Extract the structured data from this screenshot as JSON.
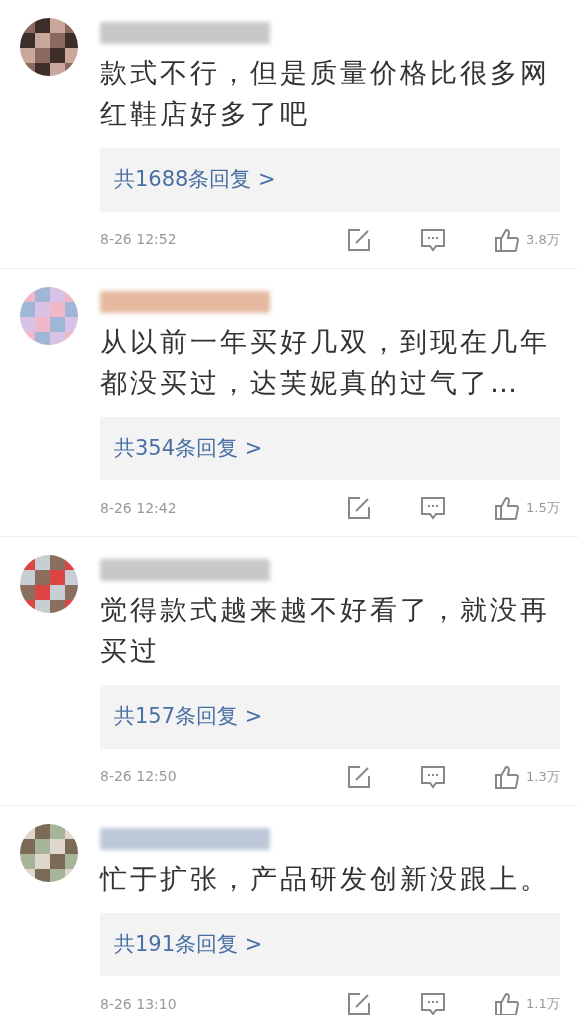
{
  "comments": [
    {
      "text": "款式不行，但是质量价格比很多网红鞋店好多了吧",
      "replies": "共1688条回复 >",
      "time": "8-26 12:52",
      "likes": "3.8万"
    },
    {
      "text": "从以前一年买好几双，到现在几年都没买过，达芙妮真的过气了…",
      "replies": "共354条回复 >",
      "time": "8-26 12:42",
      "likes": "1.5万"
    },
    {
      "text": "觉得款式越来越不好看了，就没再买过",
      "replies": "共157条回复 >",
      "time": "8-26 12:50",
      "likes": "1.3万"
    },
    {
      "text": "忙于扩张，产品研发创新没跟上。",
      "replies": "共191条回复 >",
      "time": "8-26 13:10",
      "likes": "1.1万"
    }
  ]
}
